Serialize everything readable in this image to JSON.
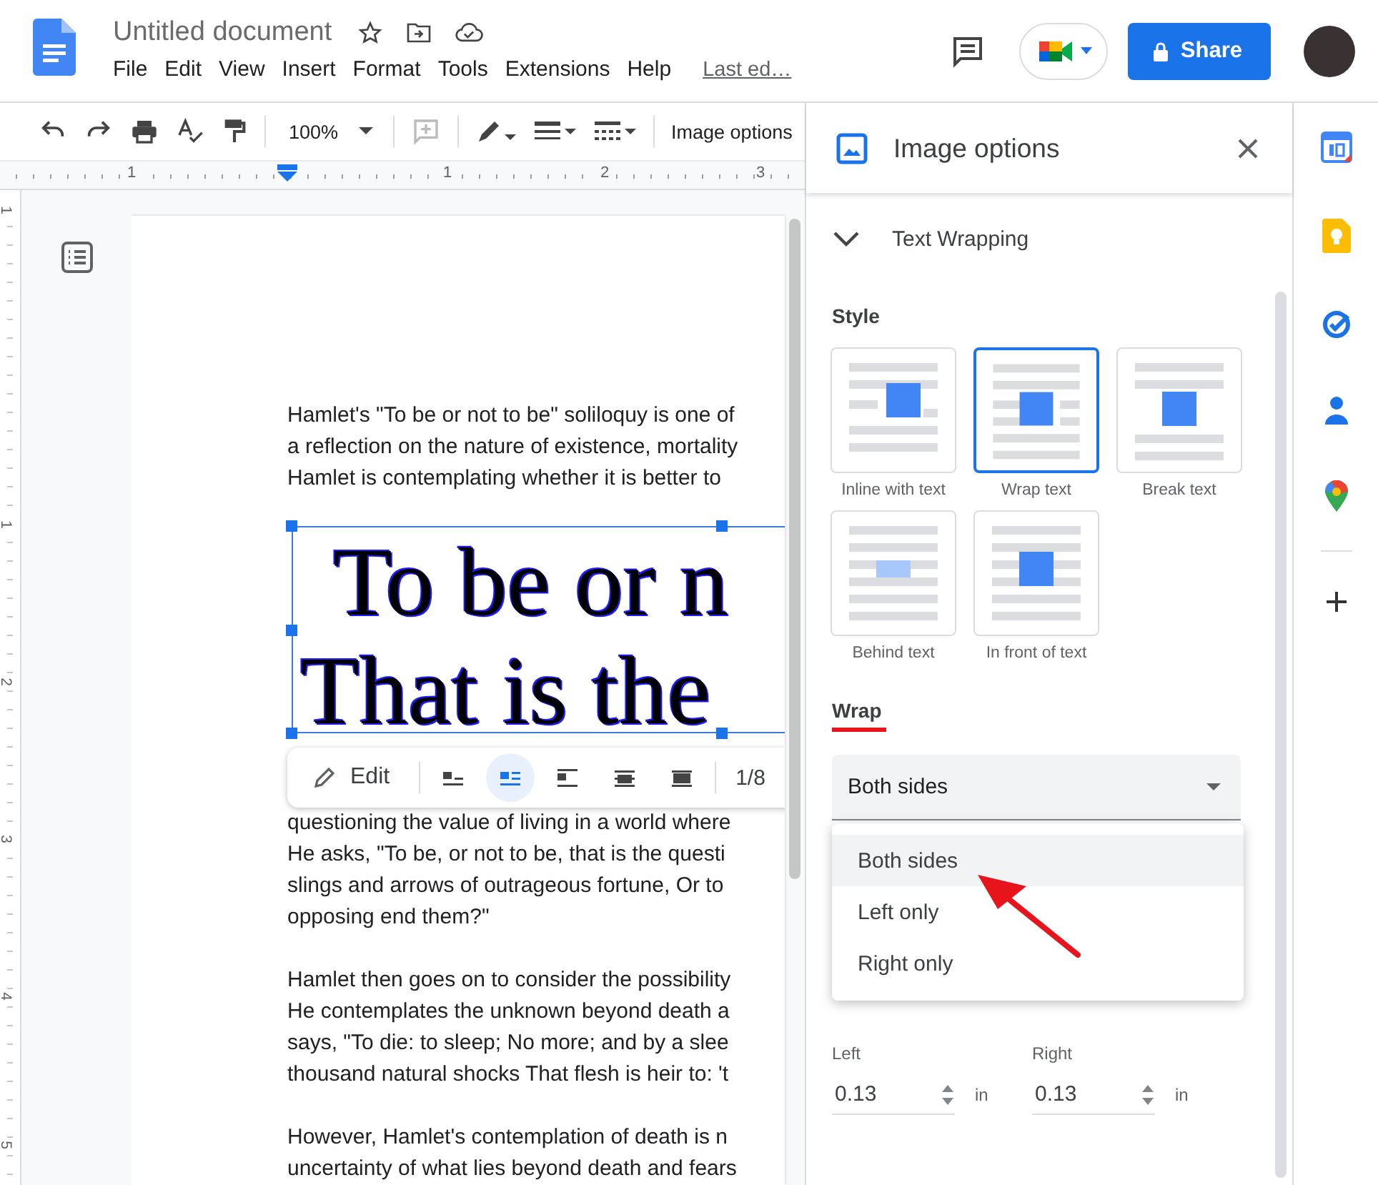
{
  "header": {
    "title": "Untitled document",
    "menus": [
      "File",
      "Edit",
      "View",
      "Insert",
      "Format",
      "Tools",
      "Extensions",
      "Help"
    ],
    "last_edit": "Last ed…",
    "share": "Share"
  },
  "toolbar": {
    "zoom": "100%",
    "image_options": "Image options"
  },
  "ruler": {
    "marks": [
      "1",
      "1",
      "2",
      "3"
    ]
  },
  "vertical_ruler": {
    "marks": [
      "1",
      "1",
      "2",
      "3",
      "4",
      "5"
    ]
  },
  "document": {
    "blocks": [
      {
        "kind": "paragraph",
        "lines": [
          "Hamlet's \"To be or not to be\" soliloquy is one of",
          "a reflection on the nature of existence, mortality",
          "Hamlet is contemplating whether it is better to"
        ]
      },
      {
        "kind": "image",
        "lines": [
          "To be or n",
          "That is the"
        ]
      },
      {
        "kind": "paragraph",
        "lines": [
          "questioning the value of living in a world where",
          "He asks, \"To be, or not to be, that is the questi",
          "slings and arrows of outrageous fortune, Or to",
          "opposing end them?\""
        ]
      },
      {
        "kind": "paragraph",
        "lines": [
          "Hamlet then goes on to consider the possibility",
          "He contemplates the unknown beyond death a",
          "says, \"To die: to sleep; No more; and by a slee",
          "thousand natural shocks That flesh is heir to: 't"
        ]
      },
      {
        "kind": "paragraph",
        "lines": [
          "However, Hamlet's contemplation of death is n",
          "uncertainty of what lies beyond death and fears"
        ]
      }
    ]
  },
  "image_toolbar": {
    "edit": "Edit",
    "modes": [
      {
        "kind": "inline",
        "selected": false
      },
      {
        "kind": "wrap",
        "selected": true
      },
      {
        "kind": "break",
        "selected": false
      },
      {
        "kind": "behind",
        "selected": false
      },
      {
        "kind": "front",
        "selected": false
      }
    ],
    "page": "1/8"
  },
  "panel": {
    "title": "Image options",
    "section": {
      "title": "Text Wrapping",
      "expanded": true
    },
    "style_label": "Style",
    "styles": [
      {
        "label": "Inline with text",
        "kind": "inline",
        "selected": false
      },
      {
        "label": "Wrap text",
        "kind": "wrap",
        "selected": true
      },
      {
        "label": "Break text",
        "kind": "break",
        "selected": false
      },
      {
        "label": "Behind text",
        "kind": "behind",
        "selected": false
      },
      {
        "label": "In front of text",
        "kind": "front",
        "selected": false
      }
    ],
    "wrap_label": "Wrap",
    "wrap_value": "Both sides",
    "wrap_menu": [
      {
        "label": "Both sides",
        "selected": true
      },
      {
        "label": "Left only",
        "selected": false
      },
      {
        "label": "Right only",
        "selected": false
      }
    ],
    "margins": [
      {
        "label": "Left",
        "value": "0.13",
        "unit": "in"
      },
      {
        "label": "Right",
        "value": "0.13",
        "unit": "in"
      }
    ]
  }
}
